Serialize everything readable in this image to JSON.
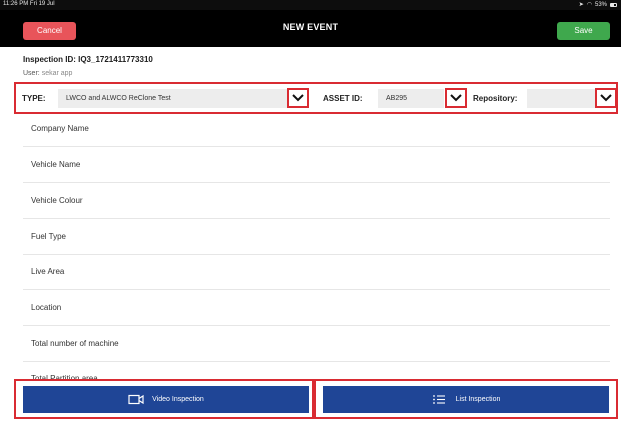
{
  "status_bar": {
    "time": "11:26 PM  Fri 19 Jul",
    "battery": "53%"
  },
  "nav": {
    "title": "NEW EVENT",
    "cancel_label": "Cancel",
    "save_label": "Save",
    "cancel_color": "#e8545a",
    "save_color": "#3fa84d"
  },
  "inspection": {
    "id_label": "Inspection ID: IQ3_1721411773310",
    "user_label": "User:",
    "user_value": "sekar app"
  },
  "filters": {
    "type_label": "TYPE:",
    "type_value": "LWCO and ALWCO ReClone Test",
    "asset_label": "ASSET ID:",
    "asset_value": "AB295",
    "repo_label": "Repository:",
    "repo_value": ""
  },
  "fields": [
    "Company Name",
    "Vehicle Name",
    "Vehicle Colour",
    "Fuel Type",
    "Live Area",
    "Location",
    "Total number of machine",
    "Total Partition area"
  ],
  "actions": {
    "video_label": "Video Inspection",
    "list_label": "List Inspection",
    "button_color": "#1f4596",
    "highlight_color": "#d92b32"
  }
}
